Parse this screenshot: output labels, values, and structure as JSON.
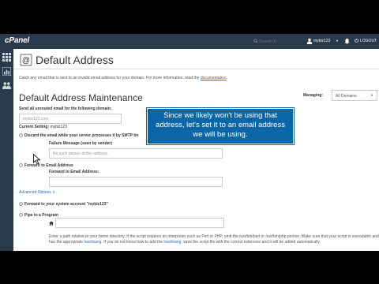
{
  "brand": {
    "logo_text": "cPanel"
  },
  "topnav": {
    "search_placeholder": "Search (/)",
    "username": "mybiz123",
    "logout_label": "LOGOUT"
  },
  "sidebar": {
    "icons": [
      "grid-icon",
      "chart-icon",
      "users-icon"
    ]
  },
  "page": {
    "title": "Default Address",
    "description": "Catch any email that is sent to an invalid email address for your domain. For more information, read the",
    "documentation_link": "documentation"
  },
  "maintenance": {
    "heading": "Default Address Maintenance",
    "managing_label": "Managing:",
    "managing_value": "All Domains",
    "send_label": "Send all unrouted email for the following domain:",
    "domain_value": "mybiz123.com",
    "current_setting_label": "Current Setting:",
    "current_setting_value": "mybiz123",
    "options": [
      {
        "label": "Discard the email while your server processes it by SMTP tin",
        "checked": false
      },
      {
        "label": "Forward to Email Address",
        "checked": false
      },
      {
        "label": "Forward to your system account \"mybiz123\"",
        "checked": true
      },
      {
        "label": "Pipe to a Program",
        "checked": false
      }
    ],
    "failure_message_label": "Failure Message (seen by sender)",
    "failure_message_placeholder": "No such person at this address.",
    "forward_email_label": "Forward to Email Address:",
    "advanced_options_label": "Advanced Options ∨",
    "pipe_hint_line1": "Enter a path relative to your home directory. If the script requires an interpreter such as Perl or PHP, omit the /usr/bin/perl or /usr/bin/php portion. Make sure that your script is",
    "pipe_hint_line2": "executable and has the appropriate",
    "pipe_hint_link1": "hashbang",
    "pipe_hint_line3": ". If you do not know how to add the",
    "pipe_hint_link2": "hashbang",
    "pipe_hint_line4": ", save the script file with the correct extension and it will be added automatically."
  },
  "tooltip": {
    "text": "Since we likely won't be using that address, let's set it to an email address we will be using."
  }
}
